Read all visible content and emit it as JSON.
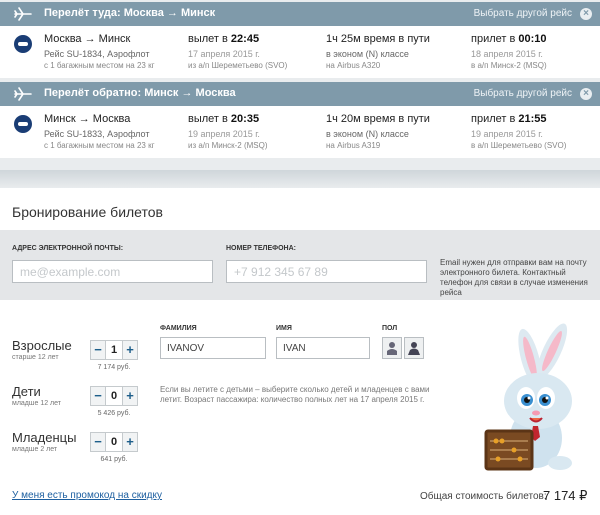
{
  "outbound": {
    "header_title": "Перелёт туда: Москва → Минск",
    "change_label": "Выбрать другой рейс",
    "route": "Москва → Минск",
    "flight": "Рейс SU-1834, Аэрофлот",
    "baggage": "с 1 багажным местом на 23 кг",
    "dep_prefix": "вылет в ",
    "dep_time": "22:45",
    "dep_date": "17 апреля 2015 г.",
    "dep_airport": "из а/п Шереметьево (SVO)",
    "duration": "1ч 25м время в пути",
    "cabin": "в эконом (N) классе",
    "aircraft": "на Airbus A320",
    "arr_prefix": "прилет в ",
    "arr_time": "00:10",
    "arr_date": "18 апреля 2015 г.",
    "arr_airport": "в а/п Минск-2 (MSQ)"
  },
  "inbound": {
    "header_title": "Перелёт обратно: Минск → Москва",
    "change_label": "Выбрать другой рейс",
    "route": "Минск → Москва",
    "flight": "Рейс SU-1833, Аэрофлот",
    "baggage": "с 1 багажным местом на 23 кг",
    "dep_prefix": "вылет в ",
    "dep_time": "20:35",
    "dep_date": "19 апреля 2015 г.",
    "dep_airport": "из а/п Минск-2 (MSQ)",
    "duration": "1ч 20м время в пути",
    "cabin": "в эконом (N) классе",
    "aircraft": "на Airbus A319",
    "arr_prefix": "прилет в ",
    "arr_time": "21:55",
    "arr_date": "19 апреля 2015 г.",
    "arr_airport": "в а/п Шереметьево (SVO)"
  },
  "booking": {
    "title": "Бронирование билетов",
    "email_label": "АДРЕС ЭЛЕКТРОННОЙ ПОЧТЫ:",
    "email_placeholder": "me@example.com",
    "phone_label": "НОМЕР ТЕЛЕФОНА:",
    "phone_placeholder": "+7 912 345 67 89",
    "contact_hint": "Email нужен для отправки вам на почту электронного билета. Контактный телефон для связи в случае изменения рейса"
  },
  "passengers": {
    "adults": {
      "label": "Взрослые",
      "sub": "старше 12 лет",
      "count": "1",
      "price": "7 174 руб."
    },
    "children": {
      "label": "Дети",
      "sub": "младше 12 лет",
      "count": "0",
      "price": "5 426 руб."
    },
    "infants": {
      "label": "Младенцы",
      "sub": "младше 2 лет",
      "count": "0",
      "price": "641 руб."
    },
    "surname_label": "ФАМИЛИЯ",
    "surname_value": "IVANOV",
    "name_label": "ИМЯ",
    "name_value": "IVAN",
    "gender_label": "ПОЛ",
    "kids_note": "Если вы летите с детьми – выберите сколько детей и младенцев с вами летит. Возраст пассажира: количество полных лет на 17 апреля 2015 г."
  },
  "footer": {
    "promo_link": "У меня есть промокод на скидку",
    "total_label": "Общая стоимость билетов:",
    "total_value": "7 174 ₽"
  },
  "icons": {
    "plane": "plane-icon",
    "close": "close-icon",
    "airline": "aeroflot-logo",
    "male": "male-icon",
    "female": "female-icon",
    "mascot": "bunny-mascot"
  },
  "colors": {
    "header_bar": "#7f9aaa",
    "link": "#1d5fa0",
    "stepper_accent": "#1d5e8a"
  }
}
